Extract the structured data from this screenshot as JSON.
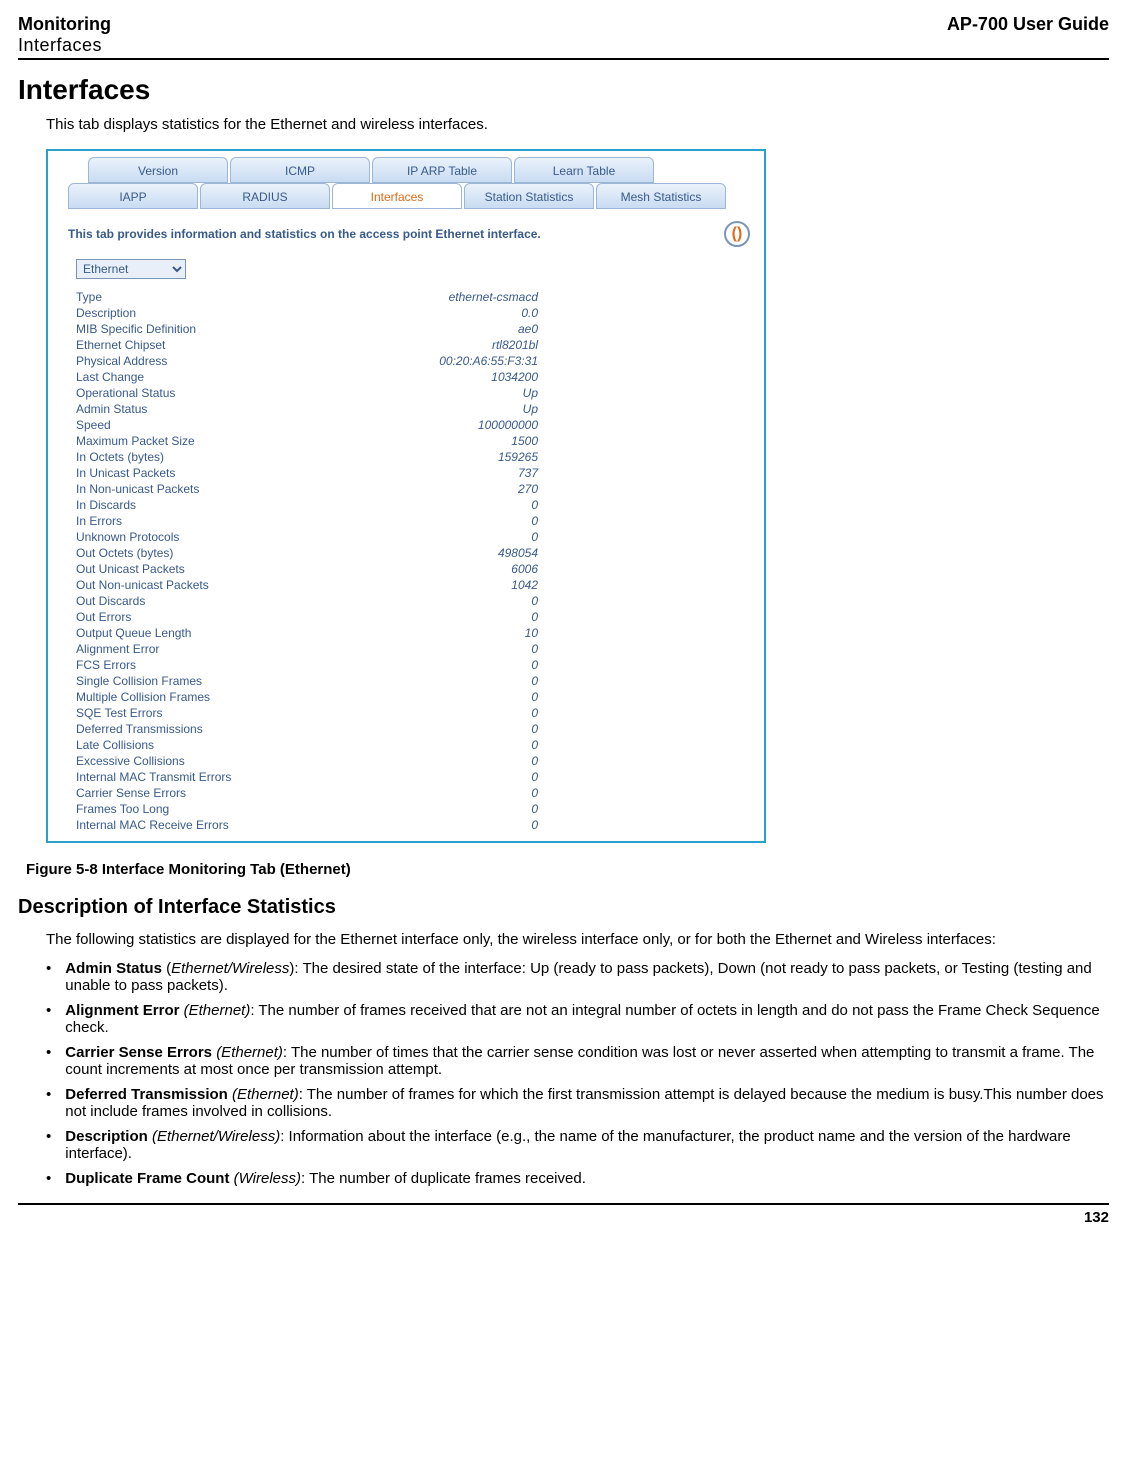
{
  "header": {
    "left_line1": "Monitoring",
    "left_line2": "Interfaces",
    "right": "AP-700 User Guide"
  },
  "section_title": "Interfaces",
  "intro": "This tab displays statistics for the Ethernet and wireless interfaces.",
  "screenshot": {
    "tabs_row1": [
      "Version",
      "ICMP",
      "IP ARP Table",
      "Learn Table"
    ],
    "tabs_row2": [
      "IAPP",
      "RADIUS",
      "Interfaces",
      "Station Statistics",
      "Mesh Statistics"
    ],
    "active_tab": "Interfaces",
    "desc": "This tab provides information and statistics on the access point Ethernet interface.",
    "help_glyph": "()",
    "dropdown_selected": "Ethernet",
    "stats": [
      {
        "k": "Type",
        "v": "ethernet-csmacd"
      },
      {
        "k": "Description",
        "v": "0.0"
      },
      {
        "k": "MIB Specific Definition",
        "v": "ae0"
      },
      {
        "k": "Ethernet Chipset",
        "v": "rtl8201bl"
      },
      {
        "k": "Physical Address",
        "v": "00:20:A6:55:F3:31"
      },
      {
        "k": "Last Change",
        "v": "1034200"
      },
      {
        "k": "Operational Status",
        "v": "Up"
      },
      {
        "k": "Admin Status",
        "v": "Up"
      },
      {
        "k": "Speed",
        "v": "100000000"
      },
      {
        "k": "Maximum Packet Size",
        "v": "1500"
      },
      {
        "k": "In Octets (bytes)",
        "v": "159265"
      },
      {
        "k": "In Unicast Packets",
        "v": "737"
      },
      {
        "k": "In Non-unicast Packets",
        "v": "270"
      },
      {
        "k": "In Discards",
        "v": "0"
      },
      {
        "k": "In Errors",
        "v": "0"
      },
      {
        "k": "Unknown Protocols",
        "v": "0"
      },
      {
        "k": "Out Octets (bytes)",
        "v": "498054"
      },
      {
        "k": "Out Unicast Packets",
        "v": "6006"
      },
      {
        "k": "Out Non-unicast Packets",
        "v": "1042"
      },
      {
        "k": "Out Discards",
        "v": "0"
      },
      {
        "k": "Out Errors",
        "v": "0"
      },
      {
        "k": "Output Queue Length",
        "v": "10"
      },
      {
        "k": "Alignment Error",
        "v": "0"
      },
      {
        "k": "FCS Errors",
        "v": "0"
      },
      {
        "k": "Single Collision Frames",
        "v": "0"
      },
      {
        "k": "Multiple Collision Frames",
        "v": "0"
      },
      {
        "k": "SQE Test Errors",
        "v": "0"
      },
      {
        "k": "Deferred Transmissions",
        "v": "0"
      },
      {
        "k": "Late Collisions",
        "v": "0"
      },
      {
        "k": "Excessive Collisions",
        "v": "0"
      },
      {
        "k": "Internal MAC Transmit Errors",
        "v": "0"
      },
      {
        "k": "Carrier Sense Errors",
        "v": "0"
      },
      {
        "k": "Frames Too Long",
        "v": "0"
      },
      {
        "k": "Internal MAC Receive Errors",
        "v": "0"
      }
    ]
  },
  "figure_caption": "Figure 5-8 Interface Monitoring Tab (Ethernet)",
  "subheading": "Description of Interface Statistics",
  "sub_intro": "The following statistics are displayed for the Ethernet interface only, the wireless interface only, or for both the Ethernet and Wireless interfaces:",
  "bullets": [
    {
      "term": "Admin Status",
      "scope": "(Ethernet/Wireless)",
      "scope_wrap": "paren",
      "text": ": The desired state of the interface: Up (ready to pass packets), Down (not ready to pass packets, or Testing (testing and unable to pass packets)."
    },
    {
      "term": "Alignment Error",
      "scope": "(Ethernet)",
      "scope_wrap": "italic",
      "text": ": The number of frames received that are not an integral number of octets in length and do not pass the Frame Check Sequence check."
    },
    {
      "term": "Carrier Sense Errors",
      "scope": "(Ethernet)",
      "scope_wrap": "italic",
      "text": ": The number of times that the carrier sense condition was lost or never asserted when attempting to transmit a frame. The count increments at most once per transmission attempt."
    },
    {
      "term": "Deferred Transmission",
      "scope": "(Ethernet)",
      "scope_wrap": "italic",
      "text": ": The number of frames for which the first transmission attempt is delayed because the medium is busy.This number does not include frames involved in collisions."
    },
    {
      "term": "Description",
      "scope": "(Ethernet/Wireless)",
      "scope_wrap": "italic",
      "text": ": Information about the interface (e.g., the name of the manufacturer, the product name and the version of the hardware interface)."
    },
    {
      "term": "Duplicate Frame Count",
      "scope": "(Wireless)",
      "scope_wrap": "italic",
      "text": ": The number of duplicate frames received."
    }
  ],
  "page_number": "132"
}
